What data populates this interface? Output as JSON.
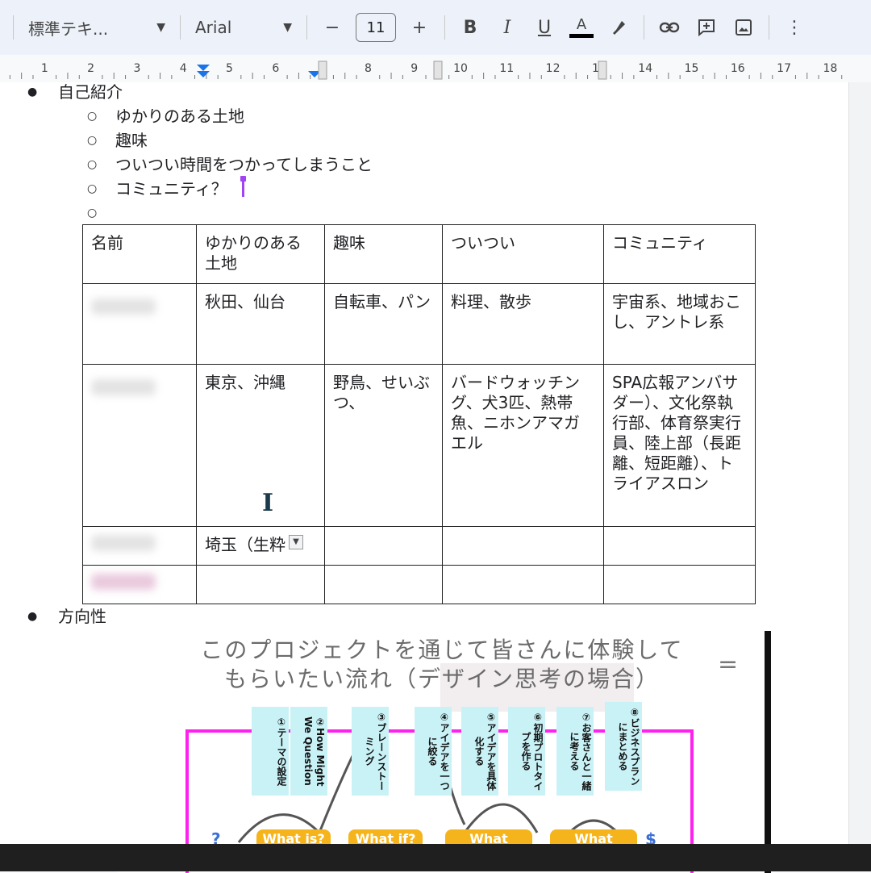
{
  "toolbar": {
    "style_select": "標準テキ...",
    "font_select": "Arial",
    "decrease_font": "−",
    "font_size": "11",
    "increase_font": "+",
    "bold": "B",
    "italic": "I",
    "underline": "U",
    "text_color": "A",
    "more": "⋮"
  },
  "ruler": {
    "numbers": [
      "1",
      "2",
      "3",
      "4",
      "5",
      "6",
      "8",
      "9",
      "10",
      "11",
      "12",
      "13",
      "14",
      "15",
      "16",
      "17",
      "18"
    ]
  },
  "document": {
    "bullet_1": "自己紹介",
    "sub_items": [
      "ゆかりのある土地",
      "趣味",
      "ついつい時間をつかってしまうこと",
      "コミュニティ？",
      ""
    ],
    "bullet_2": "方向性"
  },
  "table": {
    "headers": [
      "名前",
      "ゆかりのある土地",
      "趣味",
      "ついつい",
      "コミュニティ"
    ],
    "rows": [
      [
        "",
        "秋田、仙台",
        "自転車、パン",
        "料理、散歩",
        "宇宙系、地域おこし、アントレ系"
      ],
      [
        "",
        "東京、沖縄",
        "野鳥、せいぶつ、",
        "バードウォッチング、犬3匹、熱帯魚、ニホンアマガエル",
        "SPA広報アンバサダー）、文化祭執行部、体育祭実行員、陸上部（長距離、短距離）、トライアスロン"
      ],
      [
        "",
        "埼玉（生粋",
        "",
        "",
        ""
      ],
      [
        "",
        "",
        "",
        "",
        ""
      ]
    ]
  },
  "slide": {
    "title_line1": "このプロジェクトを通じて皆さんに体験して",
    "title_line2": "もらいたい流れ（デザイン思考の場合）",
    "eq": "=",
    "steps": [
      "①テーマの設定",
      "②How Might We Question",
      "③ブレーンストーミング",
      "④アイデアを一つに絞る",
      "⑤アイデアを具体化する",
      "⑥初期プロトタイプを作る",
      "⑦お客さんと一緒に考える",
      "⑧ビジネスプランにまとめる"
    ],
    "pills": [
      "What is?",
      "What if?",
      "What",
      "What"
    ],
    "left_mark": "?",
    "right_mark": "$"
  },
  "colors": {
    "accent_cursor": "#a142f4",
    "frame": "#ff21ee",
    "step_bg": "#c9f2f7",
    "pill": "#f6b41c"
  }
}
